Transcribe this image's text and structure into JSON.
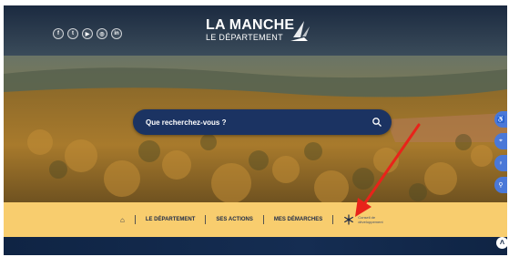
{
  "header": {
    "social_icons": [
      "facebook-icon",
      "twitter-icon",
      "youtube-icon",
      "instagram-icon",
      "linkedin-icon"
    ],
    "social_glyphs": [
      "f",
      "t",
      "▶",
      "◎",
      "in"
    ],
    "logo_line1": "LA MANCHE",
    "logo_line2": "LE DÉPARTEMENT"
  },
  "search": {
    "placeholder": "Que recherchez-vous ?",
    "icon": "search-icon"
  },
  "side_tools": {
    "icons": [
      "accessibility-icon",
      "location-icon",
      "lightbulb-icon",
      "link-icon"
    ],
    "glyphs": [
      "♿",
      "⌖",
      "♀",
      "⚲"
    ]
  },
  "nav": {
    "home_glyph": "⌂",
    "items": [
      "LE DÉPARTEMENT",
      "SES ACTIONS",
      "MES DÉMARCHES"
    ],
    "cdc_label": "Conseil de développement"
  },
  "scroll_top_glyph": "˄",
  "colors": {
    "navbar": "#f8cd6e",
    "search_bg": "#1b3362",
    "side_button": "#4a78d8",
    "bottom_bar": "#0f2444",
    "annotation_arrow": "#e8231a"
  }
}
